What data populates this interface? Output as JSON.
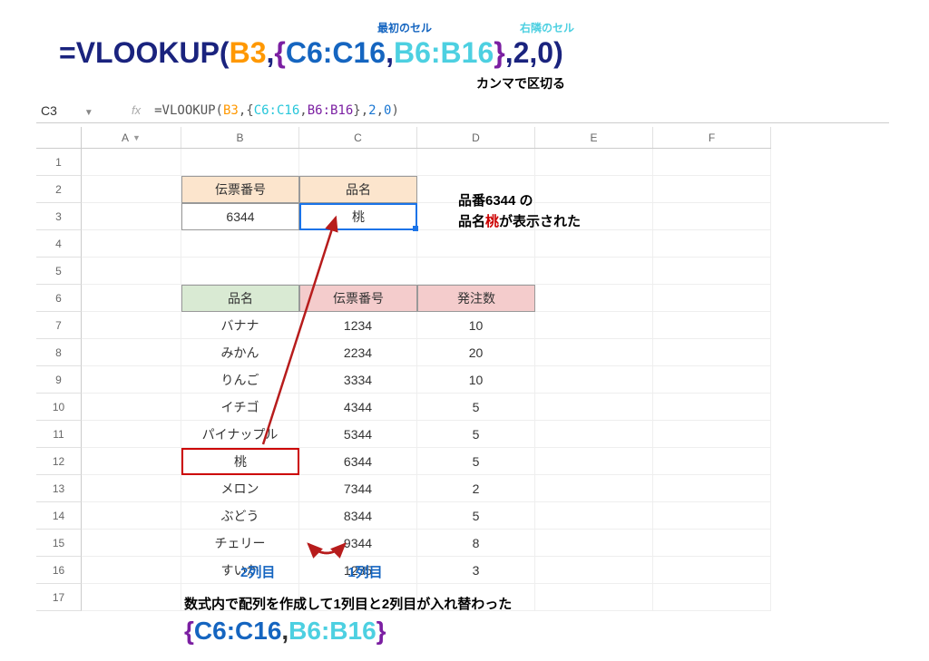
{
  "annotations": {
    "first_cell": "最初のセル",
    "right_cell": "右隣のセル",
    "comma_sep": "カンマで区切る",
    "side_line1_pre": "品番6344 の",
    "side_line2_pre": "品名",
    "side_line2_red": "桃",
    "side_line2_post": "が表示された",
    "col2_label": "2列目",
    "col1_label": "1列目",
    "bottom_text": "数式内で配列を作成して1列目と2列目が入れ替わった"
  },
  "top_formula": {
    "eq_vlookup": "=VLOOKUP(",
    "b3": "B3",
    "comma1": ",",
    "brace_l": "{",
    "c_range": "C6:C16",
    "comma2": ",",
    "b_range": "B6:B16",
    "brace_r": "}",
    "rest": ",2,0)"
  },
  "bottom_formula": {
    "brace_l": "{",
    "c_range": "C6:C16",
    "comma": ",",
    "b_range": "B6:B16",
    "brace_r": "}"
  },
  "namebox": "C3",
  "formula_bar": {
    "pre": "=VLOOKUP(",
    "b3": "B3",
    "c1": ",{",
    "cr": "C6:C16",
    "c2": ",",
    "br": "B6:B16",
    "c3": "},",
    "n2": "2",
    "c4": ",",
    "n0": "0",
    "end": ")"
  },
  "cols": [
    "A",
    "B",
    "C",
    "D",
    "E",
    "F"
  ],
  "rows": {
    "r1": {
      "num": "1"
    },
    "r2": {
      "num": "2",
      "B": "伝票番号",
      "C": "品名"
    },
    "r3": {
      "num": "3",
      "B": "6344",
      "C": "桃"
    },
    "r4": {
      "num": "4"
    },
    "r5": {
      "num": "5"
    },
    "r6": {
      "num": "6",
      "B": "品名",
      "C": "伝票番号",
      "D": "発注数"
    },
    "r7": {
      "num": "7",
      "B": "バナナ",
      "C": "1234",
      "D": "10"
    },
    "r8": {
      "num": "8",
      "B": "みかん",
      "C": "2234",
      "D": "20"
    },
    "r9": {
      "num": "9",
      "B": "りんご",
      "C": "3334",
      "D": "10"
    },
    "r10": {
      "num": "10",
      "B": "イチゴ",
      "C": "4344",
      "D": "5"
    },
    "r11": {
      "num": "11",
      "B": "パイナップル",
      "C": "5344",
      "D": "5"
    },
    "r12": {
      "num": "12",
      "B": "桃",
      "C": "6344",
      "D": "5"
    },
    "r13": {
      "num": "13",
      "B": "メロン",
      "C": "7344",
      "D": "2"
    },
    "r14": {
      "num": "14",
      "B": "ぶどう",
      "C": "8344",
      "D": "5"
    },
    "r15": {
      "num": "15",
      "B": "チェリー",
      "C": "9344",
      "D": "8"
    },
    "r16": {
      "num": "16",
      "B": "すいか",
      "C": "1235",
      "D": "3"
    },
    "r17": {
      "num": "17"
    }
  }
}
